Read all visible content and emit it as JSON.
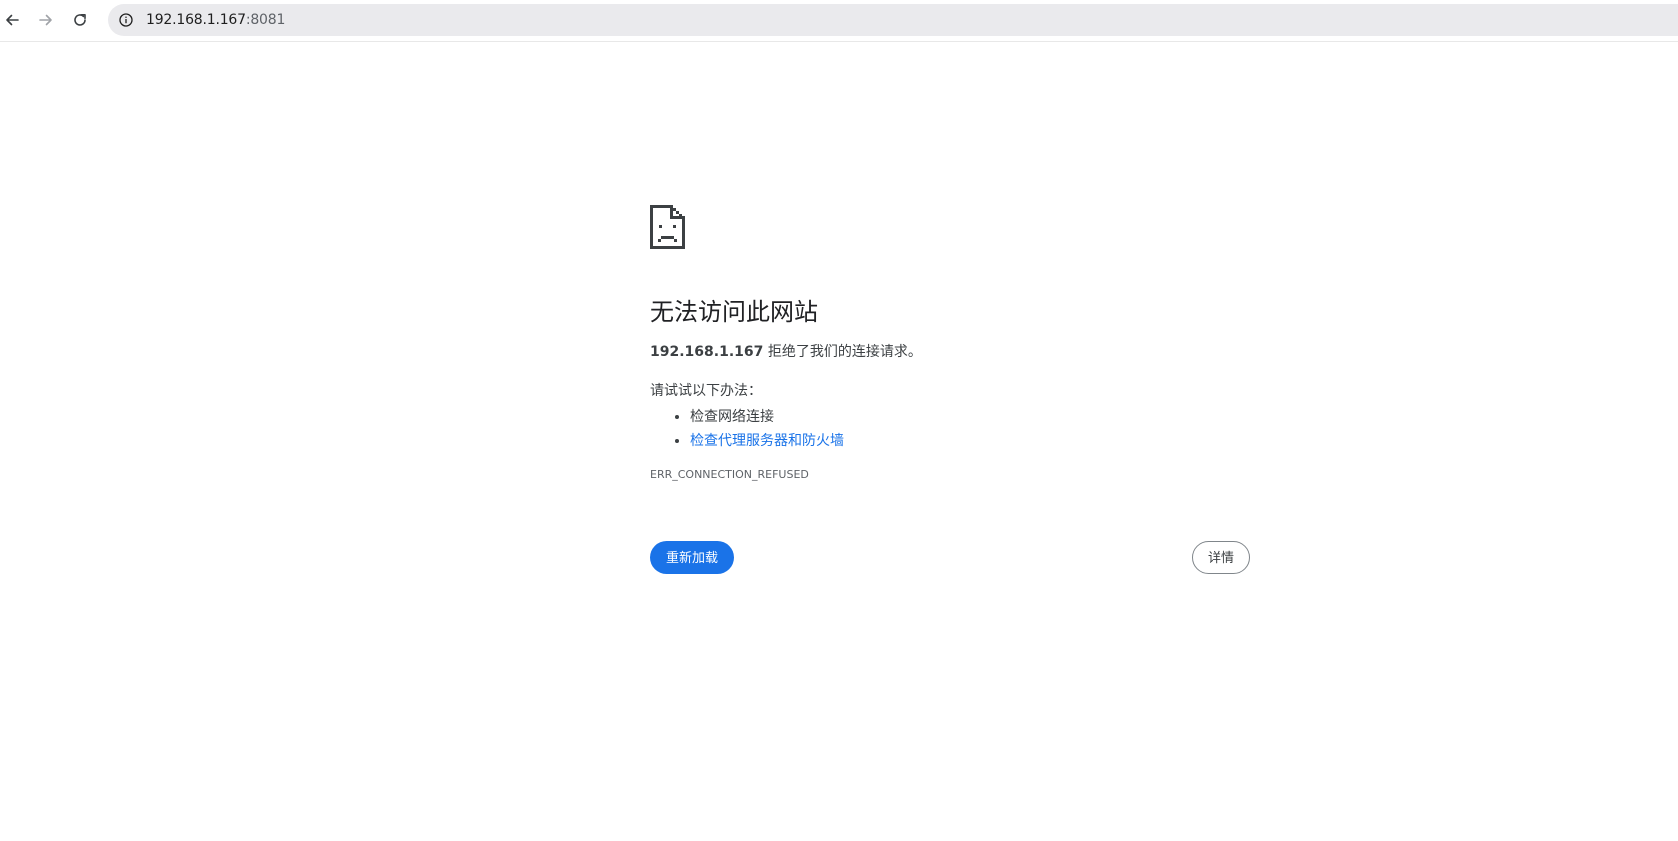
{
  "browser": {
    "back_icon": "arrow-left-icon",
    "forward_icon": "arrow-right-icon",
    "reload_icon": "reload-icon",
    "site_info_icon": "info-icon",
    "url_host": "192.168.1.167",
    "url_port": ":8081"
  },
  "error_page": {
    "icon": "sad-page-icon",
    "heading": "无法访问此网站",
    "summary_host": "192.168.1.167",
    "summary_text": " 拒绝了我们的连接请求。",
    "try_label": "请试试以下办法：",
    "suggestions": [
      {
        "label": "检查网络连接",
        "is_link": false
      },
      {
        "label": "检查代理服务器和防火墙",
        "is_link": true
      }
    ],
    "error_code": "ERR_CONNECTION_REFUSED",
    "reload_button": "重新加载",
    "details_button": "详情"
  },
  "colors": {
    "accent": "#1a73e8",
    "text": "#3c4043",
    "omnibox_bg": "#eaeaed"
  }
}
